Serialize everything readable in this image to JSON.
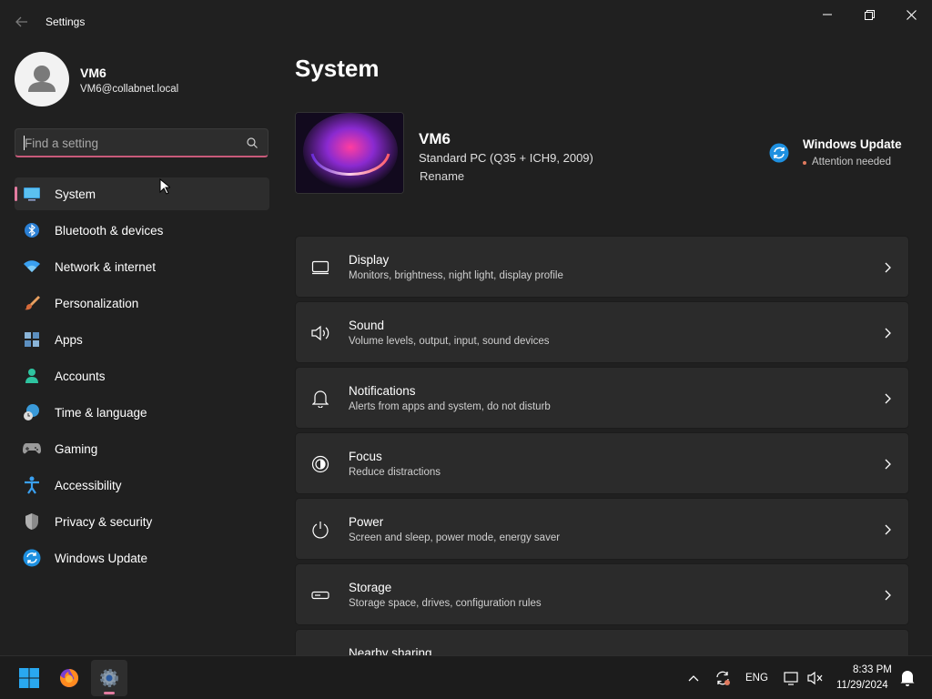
{
  "window": {
    "title": "Settings"
  },
  "profile": {
    "name": "VM6",
    "email": "VM6@collabnet.local"
  },
  "search": {
    "placeholder": "Find a setting",
    "value": ""
  },
  "sidebar": {
    "items": [
      {
        "label": "System",
        "icon": "system-icon",
        "active": true
      },
      {
        "label": "Bluetooth & devices",
        "icon": "bluetooth-icon"
      },
      {
        "label": "Network & internet",
        "icon": "wifi-icon"
      },
      {
        "label": "Personalization",
        "icon": "paintbrush-icon"
      },
      {
        "label": "Apps",
        "icon": "apps-icon"
      },
      {
        "label": "Accounts",
        "icon": "accounts-icon"
      },
      {
        "label": "Time & language",
        "icon": "time-language-icon"
      },
      {
        "label": "Gaming",
        "icon": "gamepad-icon"
      },
      {
        "label": "Accessibility",
        "icon": "accessibility-icon"
      },
      {
        "label": "Privacy & security",
        "icon": "shield-icon"
      },
      {
        "label": "Windows Update",
        "icon": "windows-update-icon"
      }
    ]
  },
  "main": {
    "title": "System",
    "device": {
      "name": "VM6",
      "model": "Standard PC (Q35 + ICH9, 2009)",
      "rename_label": "Rename"
    },
    "windows_update": {
      "title": "Windows Update",
      "status": "Attention needed"
    },
    "cards": [
      {
        "title": "Display",
        "subtitle": "Monitors, brightness, night light, display profile",
        "icon": "monitor-icon"
      },
      {
        "title": "Sound",
        "subtitle": "Volume levels, output, input, sound devices",
        "icon": "speaker-icon"
      },
      {
        "title": "Notifications",
        "subtitle": "Alerts from apps and system, do not disturb",
        "icon": "bell-icon"
      },
      {
        "title": "Focus",
        "subtitle": "Reduce distractions",
        "icon": "focus-icon"
      },
      {
        "title": "Power",
        "subtitle": "Screen and sleep, power mode, energy saver",
        "icon": "power-icon"
      },
      {
        "title": "Storage",
        "subtitle": "Storage space, drives, configuration rules",
        "icon": "storage-icon"
      },
      {
        "title": "Nearby sharing",
        "subtitle": "",
        "icon": "nearby-sharing-icon"
      }
    ]
  },
  "taskbar": {
    "language": "ENG",
    "time": "8:33 PM",
    "date": "11/29/2024"
  },
  "colors": {
    "background": "#202020",
    "card": "#2b2b2b",
    "accent": "#e27ba0",
    "taskbar": "#1c1c1c"
  }
}
